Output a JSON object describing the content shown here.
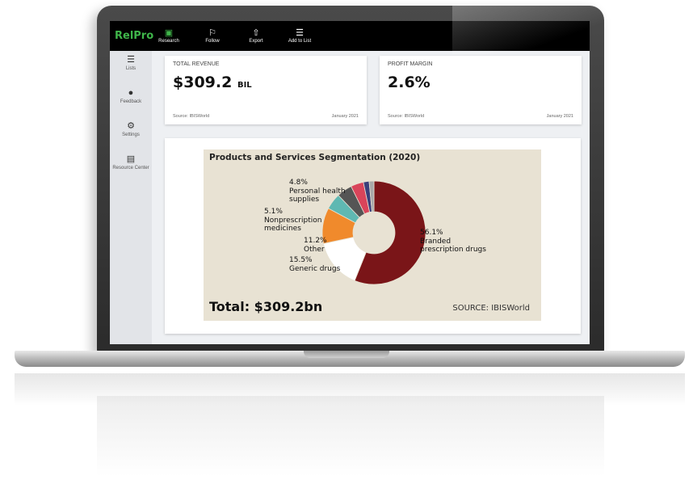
{
  "app": {
    "logo": "RelPro",
    "toolbar": [
      {
        "label": "Research",
        "icon": "research-icon",
        "glyph": "▣"
      },
      {
        "label": "Follow",
        "icon": "flag-icon",
        "glyph": "⚐"
      },
      {
        "label": "Export",
        "icon": "cloud-upload-icon",
        "glyph": "⇧"
      },
      {
        "label": "Add to List",
        "icon": "list-icon",
        "glyph": "☰"
      }
    ],
    "sidebar": [
      {
        "label": "Lists",
        "icon": "list-icon",
        "glyph": "☰"
      },
      {
        "label": "Feedback",
        "icon": "chat-bubble-icon",
        "glyph": "●"
      },
      {
        "label": "Settings",
        "icon": "gear-icon",
        "glyph": "⚙"
      },
      {
        "label": "Resource Center",
        "icon": "book-search-icon",
        "glyph": "▤"
      }
    ]
  },
  "metrics": {
    "revenue": {
      "label": "TOTAL REVENUE",
      "value": "$309.2",
      "unit": "BIL",
      "source": "Source: IBISWorld",
      "date": "January 2021"
    },
    "margin": {
      "label": "PROFIT MARGIN",
      "value": "2.6%",
      "source": "Source: IBISWorld",
      "date": "January 2021"
    }
  },
  "chart_data": {
    "type": "pie",
    "title": "Products and Services Segmentation (2020)",
    "total_label": "Total: $309.2bn",
    "source": "SOURCE: IBISWorld",
    "slices": [
      {
        "name": "Branded prescription drugs",
        "label_line1": "Branded",
        "label_line2": "prescription drugs",
        "pct_label": "56.1%",
        "value": 56.1,
        "color": "#7a1518"
      },
      {
        "name": "Generic drugs",
        "label_line1": "Generic drugs",
        "label_line2": "",
        "pct_label": "15.5%",
        "value": 15.5,
        "color": "#ffffff"
      },
      {
        "name": "Other",
        "label_line1": "Other",
        "label_line2": "",
        "pct_label": "11.2%",
        "value": 11.2,
        "color": "#f08a2c"
      },
      {
        "name": "Nonprescription medicines",
        "label_line1": "Nonprescription",
        "label_line2": "medicines",
        "pct_label": "5.1%",
        "value": 5.1,
        "color": "#5fb8b2"
      },
      {
        "name": "Personal health supplies",
        "label_line1": "Personal health",
        "label_line2": "supplies",
        "pct_label": "4.8%",
        "value": 4.8,
        "color": "#555555"
      },
      {
        "name": "",
        "label_line1": "",
        "label_line2": "",
        "pct_label": "",
        "value": 4.0,
        "color": "#d9445a"
      },
      {
        "name": "",
        "label_line1": "",
        "label_line2": "",
        "pct_label": "",
        "value": 1.8,
        "color": "#3a3f7a"
      },
      {
        "name": "",
        "label_line1": "",
        "label_line2": "",
        "pct_label": "",
        "value": 1.5,
        "color": "#a8a8a8"
      }
    ]
  }
}
